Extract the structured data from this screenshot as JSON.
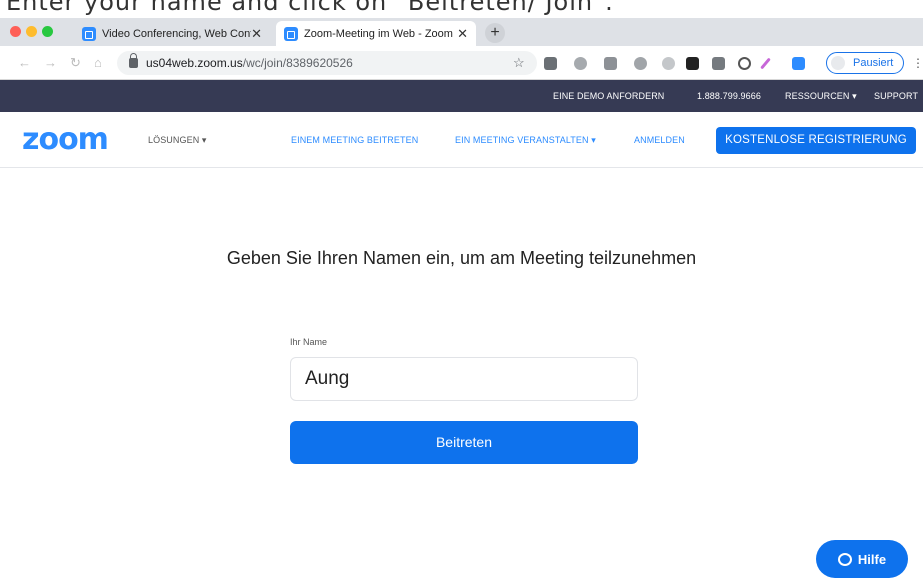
{
  "caption": "Enter your name and click on \"Beitreten/ Join\".",
  "browser": {
    "tabs": [
      {
        "title": "Video Conferencing, Web Confe",
        "active": false
      },
      {
        "title": "Zoom-Meeting im Web - Zoom",
        "active": true
      }
    ],
    "new_tab": "+",
    "url_host": "us04web.zoom.us",
    "url_path": "/wc/join/8389620526",
    "profile_label": "Pausiert",
    "colors": {
      "tab_bar": "#dee1e6",
      "profile_border": "#1a73e8"
    }
  },
  "topbar": {
    "request_demo": "EINE DEMO ANFORDERN",
    "phone": "1.888.799.9666",
    "resources": "RESSOURCEN",
    "support": "SUPPORT"
  },
  "nav": {
    "logo": "zoom",
    "solutions": "LÖSUNGEN",
    "join_meeting": "EINEM MEETING BEITRETEN",
    "host_meeting": "EIN MEETING VERANSTALTEN",
    "sign_in": "ANMELDEN",
    "register": "KOSTENLOSE REGISTRIERUNG"
  },
  "main": {
    "heading": "Geben Sie Ihren Namen ein, um am Meeting teilzunehmen",
    "name_label": "Ihr Name",
    "name_value": "Aung",
    "join_button": "Beitreten"
  },
  "help_button": "Hilfe",
  "colors": {
    "brand_blue": "#0e72ed",
    "logo_blue": "#2d8cff",
    "topbar_bg": "#363a54"
  }
}
